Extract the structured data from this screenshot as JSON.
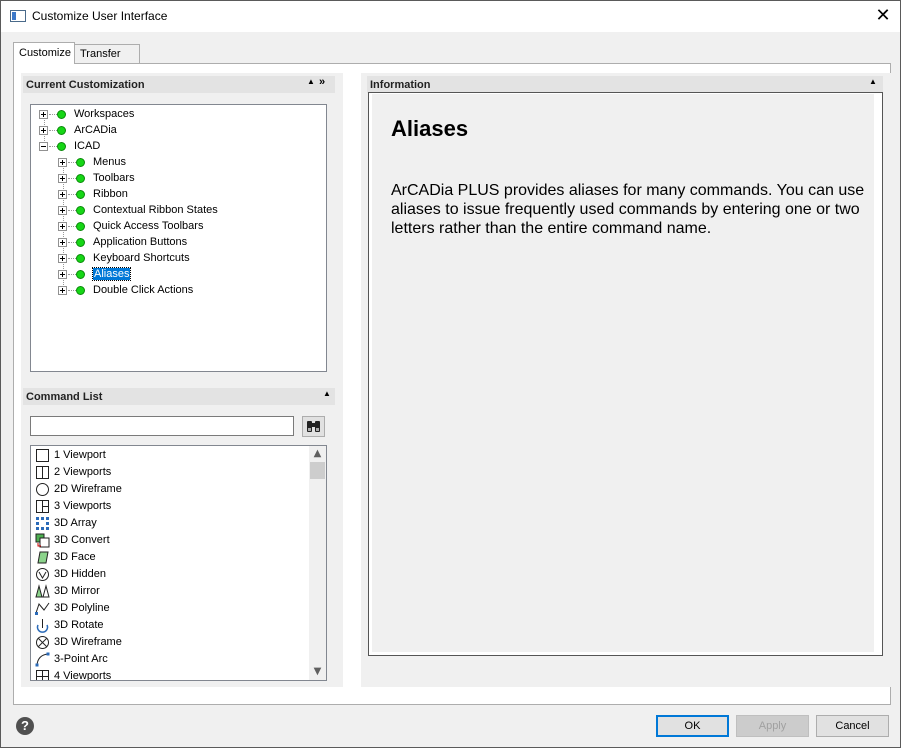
{
  "window": {
    "title": "Customize User Interface",
    "close_glyph": "✕"
  },
  "tabs": [
    {
      "label": "Customize",
      "active": true
    },
    {
      "label": "Transfer",
      "active": false
    }
  ],
  "current_customization": {
    "header": "Current Customization",
    "tree": [
      {
        "label": "Workspaces",
        "level": 0,
        "expanded": false
      },
      {
        "label": "ArCADia",
        "level": 0,
        "expanded": false
      },
      {
        "label": "ICAD",
        "level": 0,
        "expanded": true
      },
      {
        "label": "Menus",
        "level": 1,
        "expanded": false
      },
      {
        "label": "Toolbars",
        "level": 1,
        "expanded": false
      },
      {
        "label": "Ribbon",
        "level": 1,
        "expanded": false
      },
      {
        "label": "Contextual Ribbon States",
        "level": 1,
        "expanded": false
      },
      {
        "label": "Quick Access Toolbars",
        "level": 1,
        "expanded": false
      },
      {
        "label": "Application Buttons",
        "level": 1,
        "expanded": false
      },
      {
        "label": "Keyboard Shortcuts",
        "level": 1,
        "expanded": false
      },
      {
        "label": "Aliases",
        "level": 1,
        "expanded": false,
        "selected": true
      },
      {
        "label": "Double Click Actions",
        "level": 1,
        "expanded": false
      }
    ],
    "status_color": "#16d616"
  },
  "command_list": {
    "header": "Command List",
    "search": {
      "value": "",
      "placeholder": ""
    },
    "items": [
      {
        "label": "1 Viewport",
        "icon": "single-viewport-icon"
      },
      {
        "label": "2 Viewports",
        "icon": "two-viewports-icon"
      },
      {
        "label": "2D Wireframe",
        "icon": "wireframe-2d-icon"
      },
      {
        "label": "3 Viewports",
        "icon": "three-viewports-icon"
      },
      {
        "label": "3D Array",
        "icon": "array-3d-icon"
      },
      {
        "label": "3D Convert",
        "icon": "convert-3d-icon"
      },
      {
        "label": "3D Face",
        "icon": "face-3d-icon"
      },
      {
        "label": "3D Hidden",
        "icon": "hidden-3d-icon"
      },
      {
        "label": "3D Mirror",
        "icon": "mirror-3d-icon"
      },
      {
        "label": "3D Polyline",
        "icon": "polyline-3d-icon"
      },
      {
        "label": "3D Rotate",
        "icon": "rotate-3d-icon"
      },
      {
        "label": "3D Wireframe",
        "icon": "wireframe-3d-icon"
      },
      {
        "label": "3-Point Arc",
        "icon": "three-point-arc-icon"
      },
      {
        "label": "4 Viewports",
        "icon": "four-viewports-icon"
      }
    ]
  },
  "information": {
    "header": "Information",
    "title": "Aliases",
    "body": "ArCADia PLUS provides aliases for many commands. You can use aliases to issue frequently used commands by entering one or two letters rather than the entire command name."
  },
  "footer": {
    "help": "?",
    "ok": "OK",
    "apply": "Apply",
    "cancel": "Cancel",
    "apply_enabled": false
  },
  "colors": {
    "selection": "#0078d7",
    "default_button_border": "#0078d7"
  }
}
